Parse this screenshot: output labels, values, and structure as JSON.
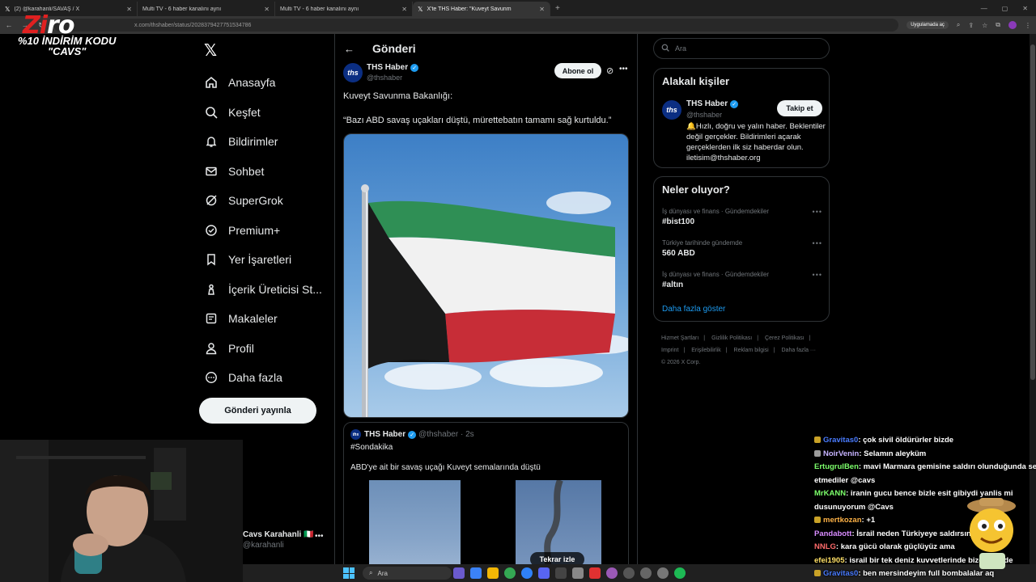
{
  "browser": {
    "tabs": [
      {
        "label": "(2) @karahanli/SAVAŞ / X",
        "active": false
      },
      {
        "label": "Multi TV - 6 haber kanalını aynı",
        "active": false
      },
      {
        "label": "Multi TV - 6 haber kanalını aynı",
        "active": false
      },
      {
        "label": "X'te THS Haber: \"Kuveyt Savunm",
        "active": true
      }
    ],
    "url": "x.com/thshaber/status/2028379427751534786",
    "app_button": "Uygulamada aç"
  },
  "overlay": {
    "logo_text_a": "Zi",
    "logo_text_b": "ro",
    "promo_line1": "%10 İNDİRİM KODU",
    "promo_line2": "\"CAVS\""
  },
  "nav": {
    "items": [
      {
        "label": "Anasayfa",
        "icon": "home-icon"
      },
      {
        "label": "Keşfet",
        "icon": "search-icon"
      },
      {
        "label": "Bildirimler",
        "icon": "bell-icon"
      },
      {
        "label": "Sohbet",
        "icon": "mail-icon"
      },
      {
        "label": "SuperGrok",
        "icon": "grok-icon"
      },
      {
        "label": "Premium+",
        "icon": "verified-icon"
      },
      {
        "label": "Yer İşaretleri",
        "icon": "bookmark-icon"
      },
      {
        "label": "İçerik Üreticisi St...",
        "icon": "creator-icon"
      },
      {
        "label": "Makaleler",
        "icon": "article-icon"
      },
      {
        "label": "Profil",
        "icon": "person-icon"
      },
      {
        "label": "Daha fazla",
        "icon": "more-icon"
      }
    ],
    "post_button": "Gönderi yayınla",
    "account_name": "Cavs Karahanli 🇮🇹",
    "account_handle": "@karahanli"
  },
  "post": {
    "header_title": "Gönderi",
    "author_name": "THS Haber",
    "author_handle": "@thshaber",
    "avatar_text": "ths",
    "subscribe_label": "Abone ol",
    "text_line1": "Kuveyt Savunma Bakanlığı:",
    "text_line2": "“Bazı ABD savaş uçakları düştü, mürettebatın tamamı sağ kurtuldu.”",
    "quote": {
      "author_name": "THS Haber",
      "handle_time": "@thshaber · 2s",
      "tag": "#Sondakika",
      "text": "ABD'ye ait bir savaş uçağı Kuveyt semalarında düştü"
    },
    "replay_label": "Tekrar izle"
  },
  "sidebar": {
    "search_placeholder": "Ara",
    "related": {
      "title": "Alakalı kişiler",
      "name": "THS Haber",
      "handle": "@thshaber",
      "follow_label": "Takip et",
      "bio": "🔔Hızlı, doğru ve yalın haber. Beklentiler değil gerçekler. Bildirimleri açarak gerçeklerden ilk siz haberdar olun. iletisim@thshaber.org"
    },
    "trends": {
      "title": "Neler oluyor?",
      "items": [
        {
          "meta": "İş dünyası ve finans · Gündemdekiler",
          "name": "#bist100"
        },
        {
          "meta": "Türkiye tarihinde gündemde",
          "name": "560 ABD"
        },
        {
          "meta": "İş dünyası ve finans · Gündemdekiler",
          "name": "#altın"
        }
      ],
      "show_more": "Daha fazla göster"
    },
    "footer": [
      "Hizmet Şartları",
      "|",
      "Gizlilik Politikası",
      "|",
      "Çerez Politikası",
      "|",
      "Imprint",
      "|",
      "Erişilebilirlik",
      "|",
      "Reklam bilgisi",
      "|",
      "Daha fazla ···",
      "© 2026 X Corp."
    ]
  },
  "chat": [
    {
      "user": "Gravitas0",
      "color": "#4a7cff",
      "msg": ": çok sivil öldürürler bizde",
      "badge": "#c9a227"
    },
    {
      "user": "NoirVenin",
      "color": "#c6b3ff",
      "msg": ": Selamın aleyküm",
      "badge": "#9b9b9b"
    },
    {
      "user": "ErtugrulBen",
      "color": "#7cff6b",
      "msg": ": mavi Marmara gemisine saldırı olunduğunda ses",
      "badge": ""
    },
    {
      "user": "",
      "color": "#fff",
      "msg": "etmediler @cavs",
      "badge": ""
    },
    {
      "user": "MrKANN",
      "color": "#7cff6b",
      "msg": ": iranin gucu bence bizle esit gibiydi yanlis mi",
      "badge": ""
    },
    {
      "user": "",
      "color": "#fff",
      "msg": "dusunuyorum @Cavs",
      "badge": ""
    },
    {
      "user": "mertkozan",
      "color": "#ffb347",
      "msg": ": +1",
      "badge": "#c9a227"
    },
    {
      "user": "Pandabott",
      "color": "#d98cff",
      "msg": ": İsrail neden Türkiyeye saldırsın çıkarı ne",
      "badge": ""
    },
    {
      "user": "NNLG",
      "color": "#ff6b6b",
      "msg": ": kara gücü olarak güçlüyüz ama",
      "badge": ""
    },
    {
      "user": "efei1905",
      "color": "#ffe066",
      "msg": ": israil bir tek deniz kuvvetlerinde bizden önde",
      "badge": ""
    },
    {
      "user": "Gravitas0",
      "color": "#4a7cff",
      "msg": ": ben mersindeyim full bombalalar aq",
      "badge": "#c9a227"
    }
  ],
  "taskbar": {
    "search_placeholder": "Ara"
  }
}
